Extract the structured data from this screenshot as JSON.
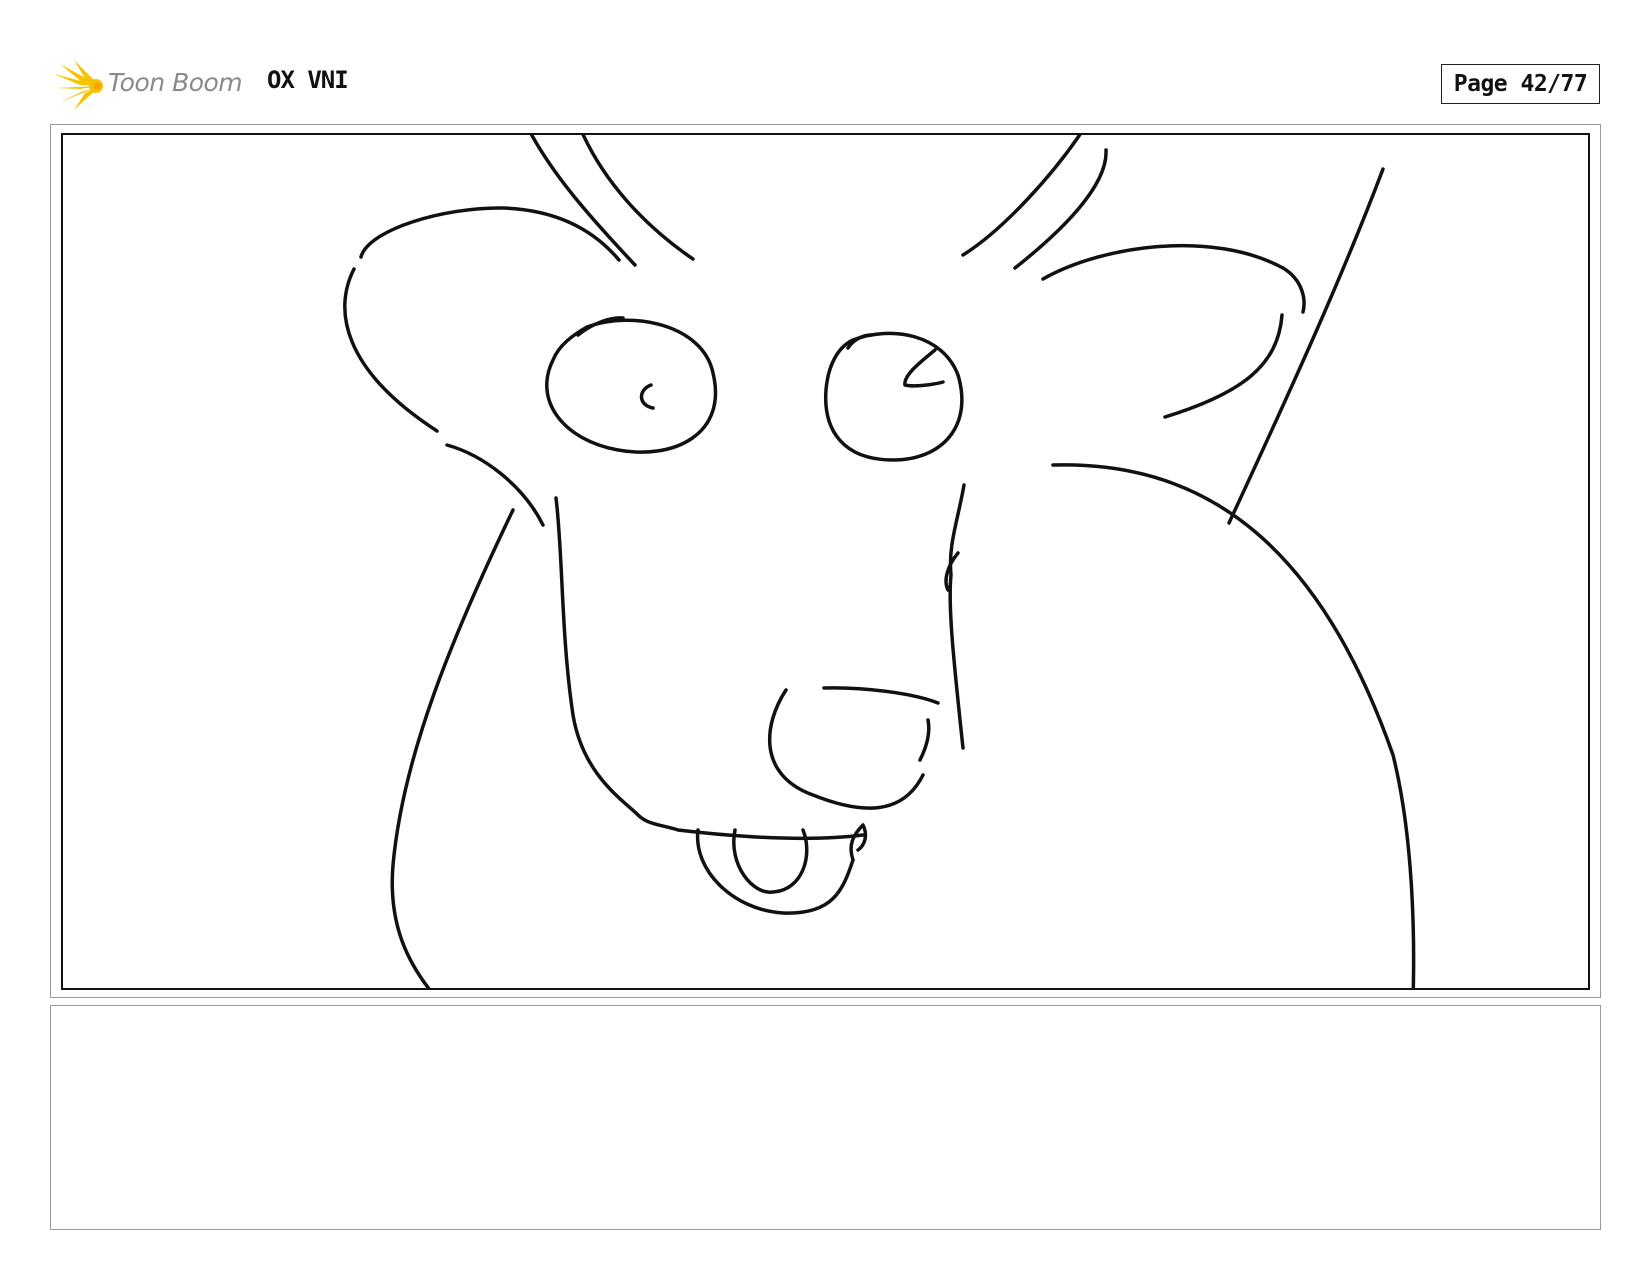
{
  "header": {
    "logo_text": "Toon Boom",
    "project_title": "OX VNI",
    "page_label": "Page 42/77"
  },
  "colors": {
    "logo_burst": "#f5c400",
    "logo_text": "#8a8a8a",
    "ink": "#111111",
    "frame": "#9a9a9a"
  },
  "panel": {
    "content": "sketch-drawing",
    "notes": ""
  }
}
